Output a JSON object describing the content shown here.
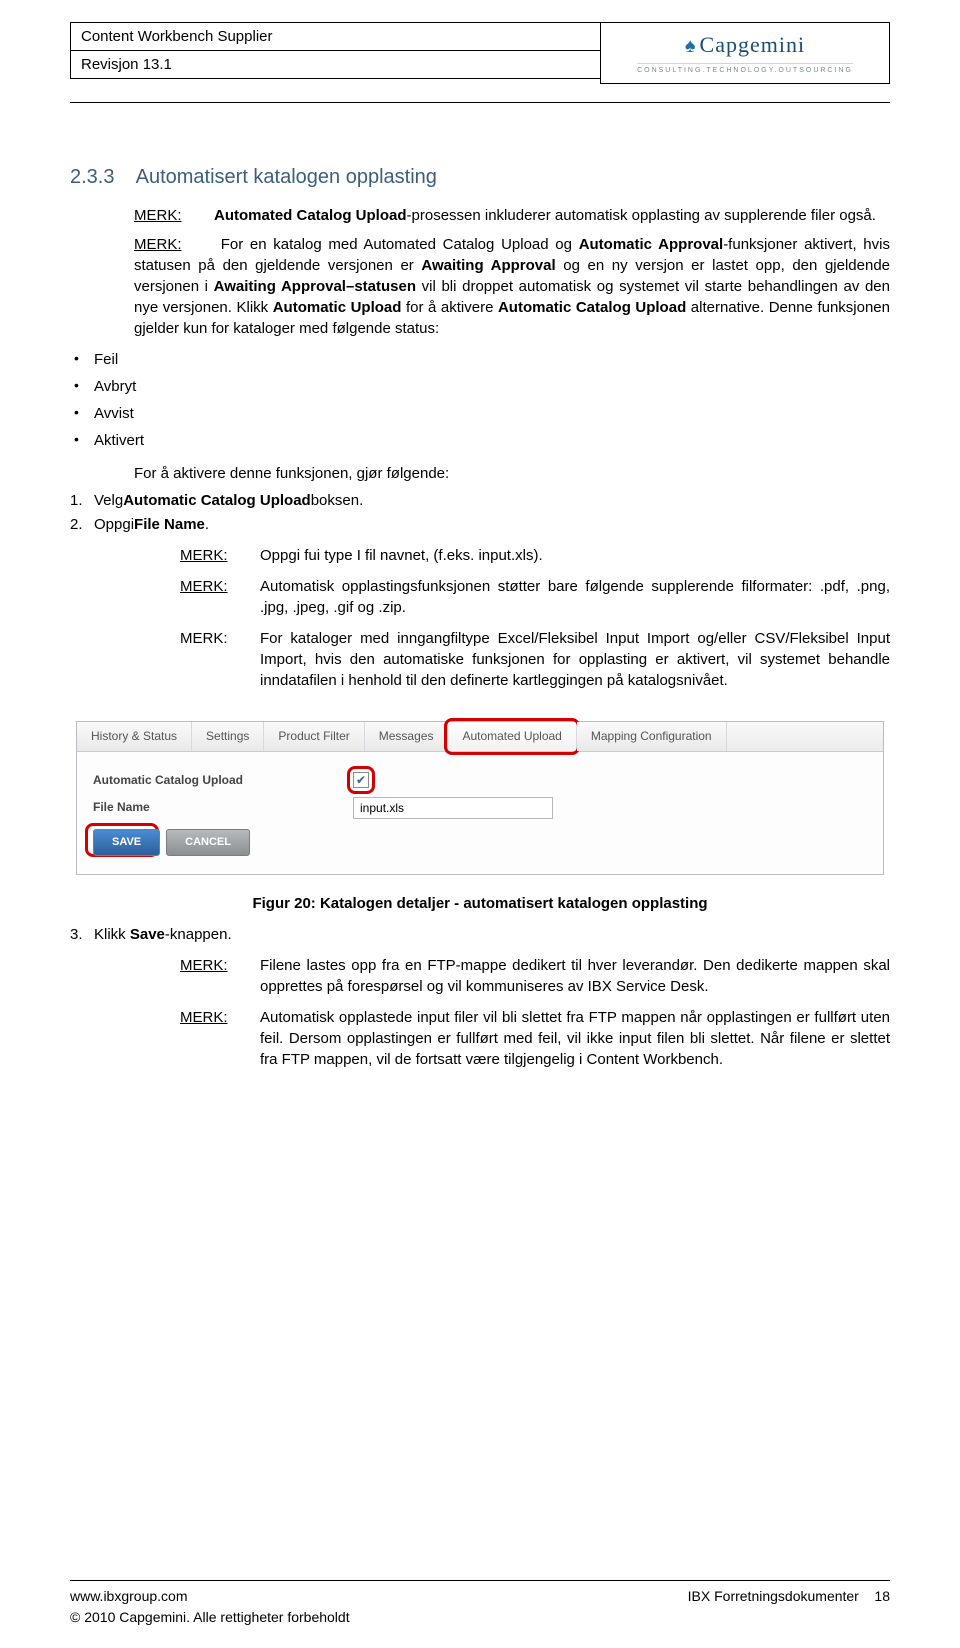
{
  "header": {
    "title": "Content Workbench Supplier",
    "revision": "Revisjon 13.1",
    "logo_name": "Capgemini",
    "logo_sub": "CONSULTING.TECHNOLOGY.OUTSOURCING"
  },
  "section": {
    "num": "2.3.3",
    "title": "Automatisert katalogen opplasting"
  },
  "notes": {
    "label": "MERK:",
    "n1_pre": "Automated Catalog Upload",
    "n1_post": "-prosessen inkluderer automatisk opplasting av supplerende filer også.",
    "n2_a": "For en katalog med Automated Catalog Upload og ",
    "n2_b": "Automatic Approval",
    "n2_c": "-funksjoner aktivert, hvis statusen på den gjeldende versjonen er ",
    "n2_d": "Awaiting Approval",
    "n2_e": " og en ny versjon er lastet opp, den gjeldende versjonen i ",
    "n2_f": "Awaiting Approval–statusen",
    "n2_g": " vil bli droppet automatisk og systemet vil starte behandlingen av den nye versjonen. Klikk ",
    "n2_h": "Automatic Upload",
    "n2_i": " for å aktivere ",
    "n2_j": "Automatic Catalog Upload",
    "n2_k": " alternative. Denne funksjonen gjelder kun for kataloger med følgende status:"
  },
  "bullets": {
    "b1": "Feil",
    "b2": "Avbryt",
    "b3": "Avvist",
    "b4": "Aktivert"
  },
  "activate_line": "For å aktivere denne funksjonen, gjør følgende:",
  "steps": {
    "s1a": "Velg",
    "s1b": "Automatic Catalog Upload",
    "s1c": "boksen.",
    "s2a": "Oppgi",
    "s2b": "File Name",
    "s2c": ".",
    "s3a": "Klikk ",
    "s3b": "Save",
    "s3c": "-knappen."
  },
  "merks": {
    "m1": "Oppgi fui type I fil navnet, (f.eks. input.xls).",
    "m2": "Automatisk opplastingsfunksjonen støtter bare følgende supplerende filformater: .pdf, .png, .jpg, .jpeg, .gif og .zip.",
    "m3": "For kataloger med inngangfiltype Excel/Fleksibel Input Import og/eller CSV/Fleksibel Input Import, hvis den automatiske funksjonen for opplasting er aktivert, vil systemet behandle inndatafilen i henhold til den definerte kartleggingen på katalogsnivået.",
    "m4": "Filene lastes opp fra en FTP-mappe dedikert til hver leverandør. Den dedikerte mappen skal opprettes på forespørsel og vil kommuniseres av  IBX Service Desk.",
    "m5": "Automatisk opplastede input filer vil bli slettet fra FTP mappen når opplastingen er fullført uten feil. Dersom opplastingen er fullført med feil, vil ikke input filen bli slettet. Når filene er slettet fra FTP mappen, vil de fortsatt være tilgjengelig i Content Workbench."
  },
  "screenshot": {
    "tabs": {
      "t1": "History & Status",
      "t2": "Settings",
      "t3": "Product Filter",
      "t4": "Messages",
      "t5": "Automated Upload",
      "t6": "Mapping Configuration"
    },
    "f1label": "Automatic Catalog Upload",
    "f2label": "File Name",
    "f2value": "input.xls",
    "save": "SAVE",
    "cancel": "CANCEL"
  },
  "figure_caption": "Figur 20: Katalogen detaljer - automatisert katalogen opplasting",
  "footer": {
    "url": "www.ibxgroup.com",
    "docline": "IBX Forretningsdokumenter",
    "page": "18",
    "copyright": "© 2010 Capgemini. Alle rettigheter forbeholdt"
  }
}
